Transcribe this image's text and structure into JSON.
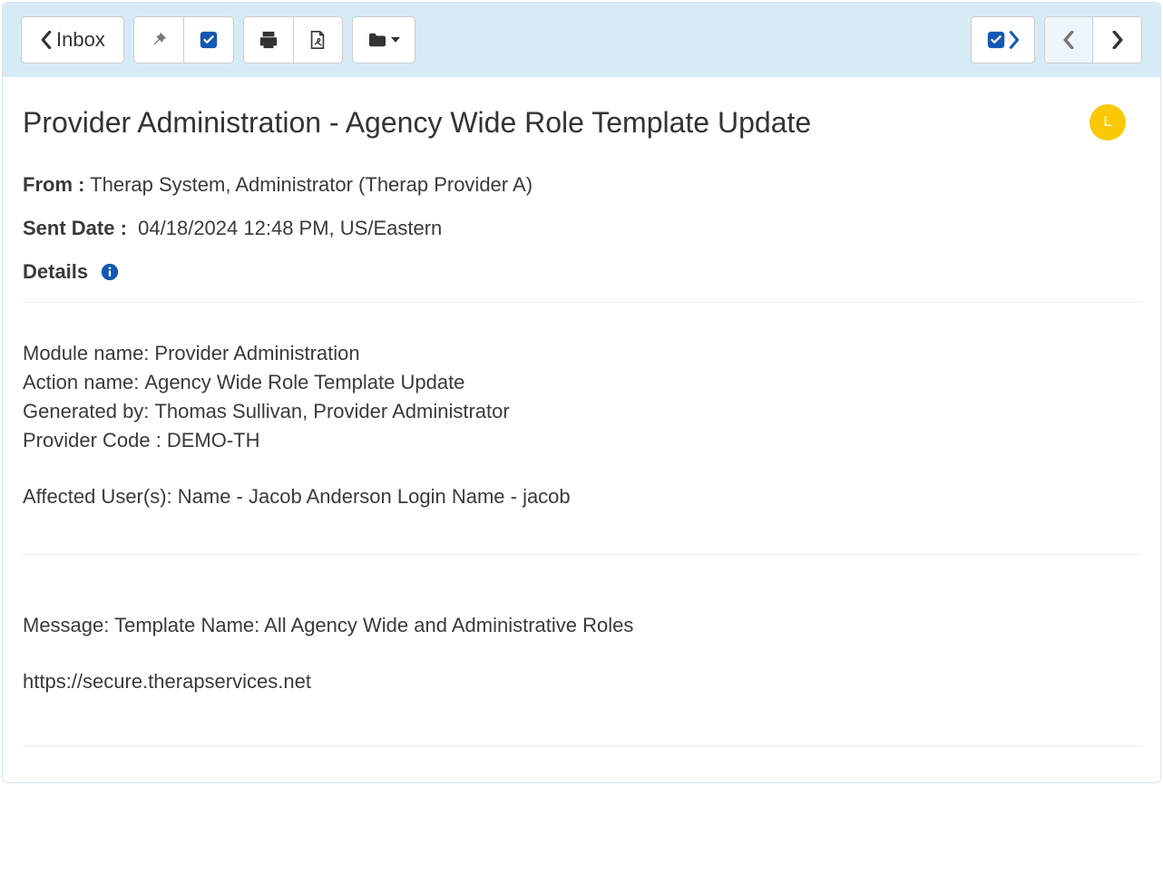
{
  "toolbar": {
    "inbox_label": "Inbox"
  },
  "message": {
    "title": "Provider Administration - Agency Wide Role Template Update",
    "avatar_letter": "L",
    "from_label": "From :",
    "from_value": " Therap System, Administrator (Therap Provider A)",
    "sent_date_label": "Sent Date :",
    "sent_date_value": "04/18/2024 12:48 PM, US/Eastern",
    "details_label": "Details"
  },
  "details": {
    "module": {
      "label": "Module name:",
      "value": "Provider Administration"
    },
    "action": {
      "label": "Action name:",
      "value": "Agency Wide Role Template Update"
    },
    "generated_by": {
      "label": "Generated by:",
      "value": "Thomas Sullivan, Provider Administrator"
    },
    "provider_code": {
      "label": "Provider Code :",
      "value": "DEMO-TH"
    },
    "affected_users": "Affected User(s): Name - Jacob Anderson Login Name - jacob"
  },
  "body": {
    "message_line": "Message: Template Name: All Agency Wide and Administrative Roles",
    "url": "https://secure.therapservices.net"
  }
}
